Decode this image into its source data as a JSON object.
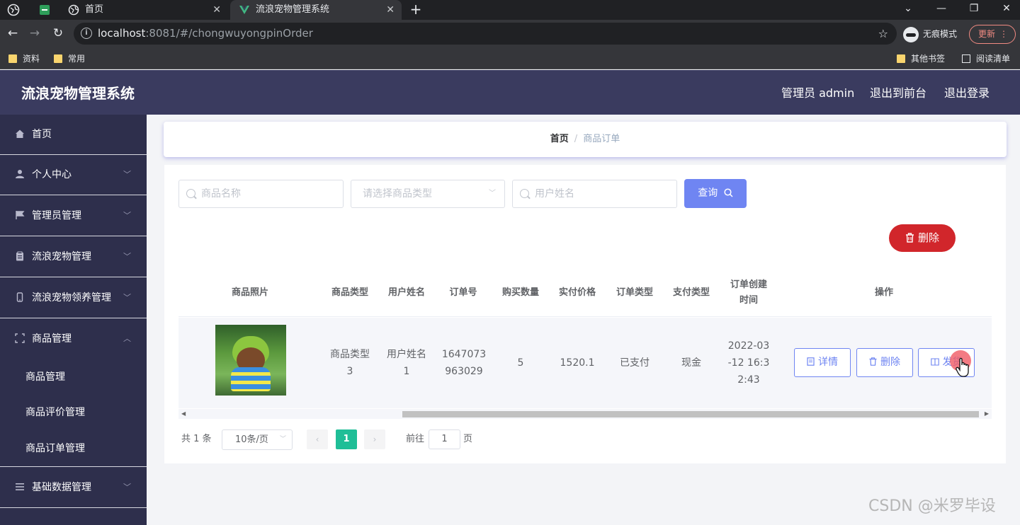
{
  "browser": {
    "tabs": [
      {
        "title": "首页"
      },
      {
        "title": "流浪宠物管理系统"
      }
    ],
    "url_host": "localhost",
    "url_rest": ":8081/#/chongwuyongpinOrder",
    "incognito_label": "无痕模式",
    "update_label": "更新",
    "bookmarks": [
      "资料",
      "常用"
    ],
    "bookmarks_right": [
      "其他书签",
      "阅读清单"
    ]
  },
  "header": {
    "title": "流浪宠物管理系统",
    "user": "管理员 admin",
    "to_front": "退出到前台",
    "logout": "退出登录"
  },
  "sidebar": {
    "items": [
      {
        "label": "首页"
      },
      {
        "label": "个人中心"
      },
      {
        "label": "管理员管理"
      },
      {
        "label": "流浪宠物管理"
      },
      {
        "label": "流浪宠物领养管理"
      },
      {
        "label": "商品管理"
      },
      {
        "label": "基础数据管理"
      }
    ],
    "sub_items": [
      "商品管理",
      "商品评价管理",
      "商品订单管理"
    ]
  },
  "breadcrumb": {
    "home": "首页",
    "sep": "/",
    "current": "商品订单"
  },
  "search": {
    "name_placeholder": "商品名称",
    "type_placeholder": "请选择商品类型",
    "user_placeholder": "用户姓名",
    "query_label": "查询"
  },
  "actions": {
    "delete_label": "删除"
  },
  "table": {
    "headers": [
      "商品照片",
      "商品类型",
      "用户姓名",
      "订单号",
      "购买数量",
      "实付价格",
      "订单类型",
      "支付类型",
      "订单创建时间",
      "操作"
    ],
    "rows": [
      {
        "type": "商品类型3",
        "user": "用户姓名1",
        "order_no": "1647073963029",
        "qty": "5",
        "price": "1520.1",
        "order_type": "已支付",
        "pay_type": "现金",
        "created": "2022-03-12 16:32:43",
        "ops": [
          "详情",
          "删除",
          "发货"
        ]
      }
    ]
  },
  "pagination": {
    "total": "共 1 条",
    "page_size": "10条/页",
    "current": "1",
    "goto": "前往",
    "goto_value": "1",
    "page_suffix": "页"
  },
  "watermark": "CSDN @米罗毕设",
  "colors": {
    "accent": "#6f85f2",
    "danger": "#d1262b",
    "header": "#3a3b5f",
    "sidebar": "#2e2f4c",
    "page_active": "#1fbe97"
  }
}
